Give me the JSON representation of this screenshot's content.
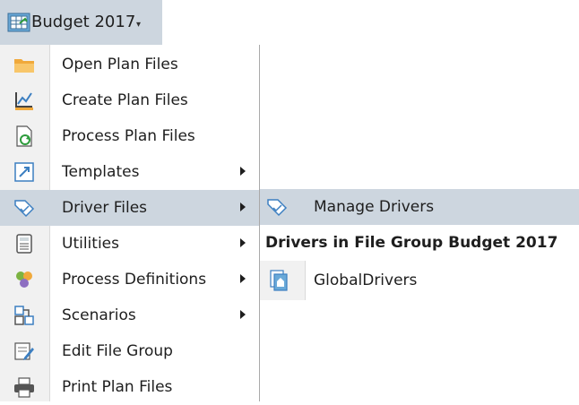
{
  "top_button": {
    "label": "Budget 2017",
    "icon": "budget-grid-icon",
    "caret": "▾"
  },
  "menu": {
    "items": [
      {
        "label": "Open Plan Files",
        "icon": "folder-open-icon",
        "submenu": false
      },
      {
        "label": "Create Plan Files",
        "icon": "create-chart-icon",
        "submenu": false
      },
      {
        "label": "Process Plan Files",
        "icon": "process-refresh-icon",
        "submenu": false
      },
      {
        "label": "Templates",
        "icon": "templates-icon",
        "submenu": true
      },
      {
        "label": "Driver Files",
        "icon": "driver-tag-icon",
        "submenu": true,
        "highlighted": true
      },
      {
        "label": "Utilities",
        "icon": "utilities-calculator-icon",
        "submenu": true
      },
      {
        "label": "Process Definitions",
        "icon": "process-definitions-icon",
        "submenu": true
      },
      {
        "label": "Scenarios",
        "icon": "scenarios-icon",
        "submenu": true
      },
      {
        "label": "Edit File Group",
        "icon": "edit-file-group-icon",
        "submenu": false
      },
      {
        "label": "Print Plan Files",
        "icon": "printer-icon",
        "submenu": false
      }
    ]
  },
  "submenu": {
    "manage_drivers": {
      "label": "Manage Drivers",
      "icon": "driver-tag-icon"
    },
    "header": "Drivers in File Group Budget 2017",
    "file": {
      "label": "GlobalDrivers",
      "icon": "global-drivers-icon"
    }
  },
  "colors": {
    "highlight": "#cdd6df",
    "gutter": "#f1f1f1",
    "folder": "#f5b54a",
    "accent_blue": "#3c7fc1"
  }
}
